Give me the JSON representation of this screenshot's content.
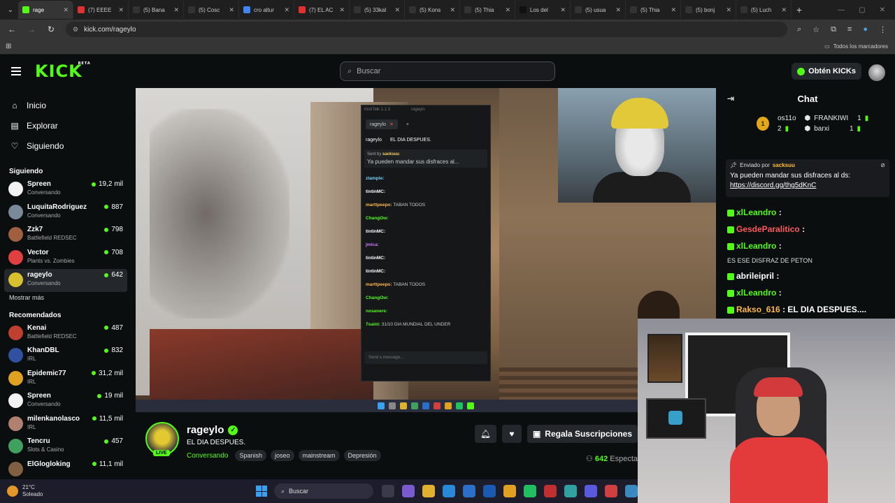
{
  "browser": {
    "tabs": [
      {
        "title": "rage",
        "color": "#53fc18",
        "icon": "kick-icon",
        "active": true
      },
      {
        "title": "(7) EEEE",
        "color": "#e23030",
        "icon": "youtube-icon"
      },
      {
        "title": "(5) Bana",
        "color": "#333333",
        "icon": "x-icon"
      },
      {
        "title": "(5) Cosc",
        "color": "#333333",
        "icon": "x-icon"
      },
      {
        "title": "cro altur",
        "color": "#4285f4",
        "icon": "google-icon"
      },
      {
        "title": "(7) EL AC",
        "color": "#e23030",
        "icon": "youtube-icon"
      },
      {
        "title": "(5) 33kal",
        "color": "#333333",
        "icon": "x-icon"
      },
      {
        "title": "(5) Kons",
        "color": "#333333",
        "icon": "x-icon"
      },
      {
        "title": "(5) Thia",
        "color": "#333333",
        "icon": "x-icon"
      },
      {
        "title": "Los del",
        "color": "#111111",
        "icon": "tiktok-icon"
      },
      {
        "title": "(5) usua",
        "color": "#333333",
        "icon": "x-icon"
      },
      {
        "title": "(5) Thia",
        "color": "#333333",
        "icon": "x-icon"
      },
      {
        "title": "(5) bonj",
        "color": "#333333",
        "icon": "x-icon"
      },
      {
        "title": "(5) Luch",
        "color": "#333333",
        "icon": "x-icon"
      }
    ],
    "url": "kick.com/rageylo",
    "bookmarks_label": "Todos los marcadores"
  },
  "header": {
    "logo": "KICK",
    "logo_sup": "BETA",
    "search_placeholder": "Buscar",
    "get_kicks": "Obtén KICKs"
  },
  "sidebar": {
    "nav": [
      {
        "label": "Inicio",
        "icon": "home-icon",
        "glyph": "⌂"
      },
      {
        "label": "Explorar",
        "icon": "browse-icon",
        "glyph": "▤"
      },
      {
        "label": "Siguiendo",
        "icon": "heart-icon",
        "glyph": "♡"
      }
    ],
    "following_title": "Siguiendo",
    "following": [
      {
        "name": "Spreen",
        "sub": "Conversando",
        "viewers": "19,2 mil",
        "color": "#f2f2f2"
      },
      {
        "name": "LuquitaRodriguez",
        "sub": "Conversando",
        "viewers": "887",
        "color": "#7a8a9a"
      },
      {
        "name": "Zzk7",
        "sub": "Battlefield REDSEC",
        "viewers": "798",
        "color": "#a06040"
      },
      {
        "name": "Vector",
        "sub": "Plants vs. Zombies",
        "viewers": "708",
        "color": "#e04040"
      },
      {
        "name": "rageylo",
        "sub": "Conversando",
        "viewers": "642",
        "color": "#d8c030"
      }
    ],
    "show_more": "Mostrar más",
    "recommended_title": "Recomendados",
    "recommended": [
      {
        "name": "Kenai",
        "sub": "Battlefield REDSEC",
        "viewers": "487",
        "color": "#c04030"
      },
      {
        "name": "KhanDBL",
        "sub": "IRL",
        "viewers": "832",
        "color": "#3050a0"
      },
      {
        "name": "Epidemic77",
        "sub": "IRL",
        "viewers": "31,2 mil",
        "color": "#e0a020"
      },
      {
        "name": "Spreen",
        "sub": "Conversando",
        "viewers": "19 mil",
        "color": "#f2f2f2"
      },
      {
        "name": "milenkanolasco",
        "sub": "IRL",
        "viewers": "11,5 mil",
        "color": "#b08070"
      },
      {
        "name": "Tencru",
        "sub": "Slots & Casino",
        "viewers": "457",
        "color": "#40a060"
      },
      {
        "name": "ElGlogloking",
        "sub": "",
        "viewers": "11,1 mil",
        "color": "#806040"
      }
    ]
  },
  "stream": {
    "channel": "rageylo",
    "title": "EL DIA DESPUES.",
    "category": "Conversando",
    "tags": [
      "Spanish",
      "joseo",
      "mainstream",
      "Depresión"
    ],
    "live": "LIVE",
    "subscribe_label": "Regala Suscripciones",
    "viewers": "642",
    "viewers_label": "Especta"
  },
  "kicktalk": {
    "title": "KickTalk 1.1.3",
    "channel": "rageylo",
    "tab": "rageylo",
    "header_title": "EL DIA DESPUES.",
    "pinned_by": "Sent by",
    "pinned_user": "sacksuu",
    "pinned_text": "Ya pueden mandar sus disfraces al...",
    "messages": [
      {
        "user": "ztample:",
        "text": "",
        "color": "#7ad0ff"
      },
      {
        "user": "tintinMC:",
        "text": "",
        "color": "#ffffff"
      },
      {
        "user": "marttpeepo:",
        "text": "TABAN TODOS",
        "color": "#ffb84a"
      },
      {
        "user": "ChangOw:",
        "text": "",
        "color": "#53fc18"
      },
      {
        "user": "tintinMC:",
        "text": "",
        "color": "#ffffff"
      },
      {
        "user": "jmica:",
        "text": "",
        "color": "#d07aff"
      },
      {
        "user": "tintinMC:",
        "text": "",
        "color": "#ffffff"
      },
      {
        "user": "tintinMC:",
        "text": "",
        "color": "#ffffff"
      },
      {
        "user": "marttpeepo:",
        "text": "TABAN TODOS",
        "color": "#ffb84a"
      },
      {
        "user": "ChangOw:",
        "text": "",
        "color": "#53fc18"
      },
      {
        "user": "nosanere:",
        "text": "",
        "color": "#53fc18"
      },
      {
        "user": "7saint:",
        "text": "31/10 DIA MUNDIAL DEL UNDER",
        "color": "#53fc18"
      }
    ],
    "input_placeholder": "Send a message..."
  },
  "chat": {
    "title": "Chat",
    "leaderboard": [
      {
        "name": "os11o",
        "count": "2"
      },
      {
        "name": "FRANKIWI",
        "count": "1"
      },
      {
        "name": "barxi",
        "count": "1"
      }
    ],
    "crown_rank": "1",
    "pinned_by": "Enviado por",
    "pinned_user": "sacksuu",
    "pinned_text": "Ya pueden mandar sus disfraces al ds:",
    "pinned_link": "https://discord.gg/thg5dKnC",
    "messages": [
      {
        "user": "xlLeandro",
        "text": ":",
        "color": "#53fc18"
      },
      {
        "user": "GesdeParalitico",
        "text": ":",
        "color": "#ff5a5a"
      },
      {
        "user": "xlLeandro",
        "text": ":",
        "color": "#53fc18"
      },
      {
        "user": "abrileipril",
        "text": ":",
        "color": "#ffffff"
      },
      {
        "user": "xlLeandro",
        "text": ":",
        "color": "#53fc18"
      },
      {
        "user": "Rakso_616",
        "text": ": EL DIA DESPUES....",
        "color": "#ffb84a"
      }
    ],
    "fragment": "ES ESE DISFRAZ DE PETON"
  },
  "taskbar": {
    "temp": "21°C",
    "weather": "Soleado",
    "search": "Buscar"
  }
}
